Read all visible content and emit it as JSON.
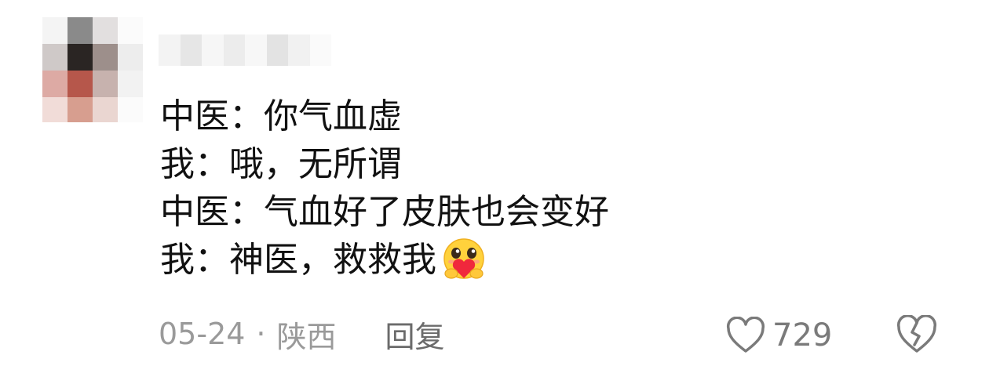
{
  "comment": {
    "lines": [
      "中医：你气血虚",
      "我：哦，无所谓",
      "中医：气血好了皮肤也会变好",
      "我：神医，救救我"
    ],
    "emoji": "hug-heart-emoji"
  },
  "meta": {
    "date": "05-24",
    "separator": "·",
    "location": "陕西",
    "reply_label": "回复"
  },
  "actions": {
    "like_count": "729",
    "like_icon": "heart-outline-icon",
    "dislike_icon": "broken-heart-icon"
  },
  "colors": {
    "text": "#111111",
    "meta_text": "#9a9a9a",
    "reply_text": "#6b6b6b",
    "icon": "#7a7a7a"
  }
}
